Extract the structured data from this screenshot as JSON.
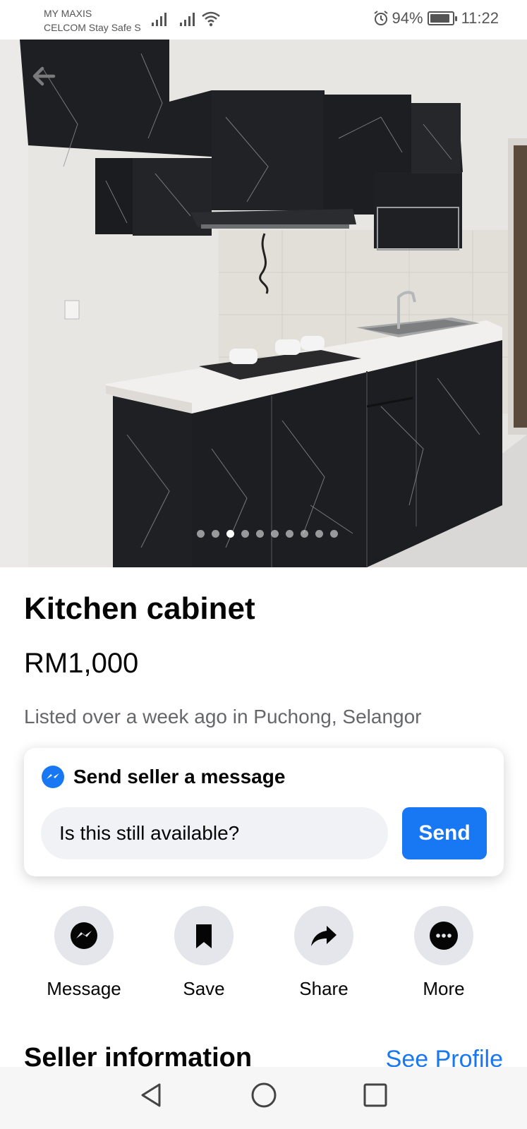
{
  "status_bar": {
    "carrier1": "MY MAXIS",
    "carrier2": "CELCOM Stay Safe S",
    "battery": "94%",
    "time": "11:22",
    "battery_level": 0.94,
    "icons": [
      "signal-icon",
      "signal-icon",
      "wifi-icon",
      "alarm-icon",
      "battery-icon"
    ]
  },
  "gallery": {
    "total": 10,
    "active_index": 2
  },
  "listing": {
    "title": "Kitchen cabinet",
    "price": "RM1,000",
    "listed": "Listed over a week ago in Puchong, Selangor"
  },
  "message_card": {
    "heading": "Send seller a message",
    "input_value": "Is this still available?",
    "send_label": "Send"
  },
  "actions": [
    {
      "label": "Message",
      "icon": "messenger-icon"
    },
    {
      "label": "Save",
      "icon": "bookmark-icon"
    },
    {
      "label": "Share",
      "icon": "share-icon"
    },
    {
      "label": "More",
      "icon": "more-icon"
    }
  ],
  "seller": {
    "heading": "Seller information",
    "see_profile": "See Profile"
  },
  "colors": {
    "accent": "#1877f2",
    "secondary_text": "#65676b",
    "action_bg": "#e4e6eb",
    "input_bg": "#f0f2f5"
  }
}
